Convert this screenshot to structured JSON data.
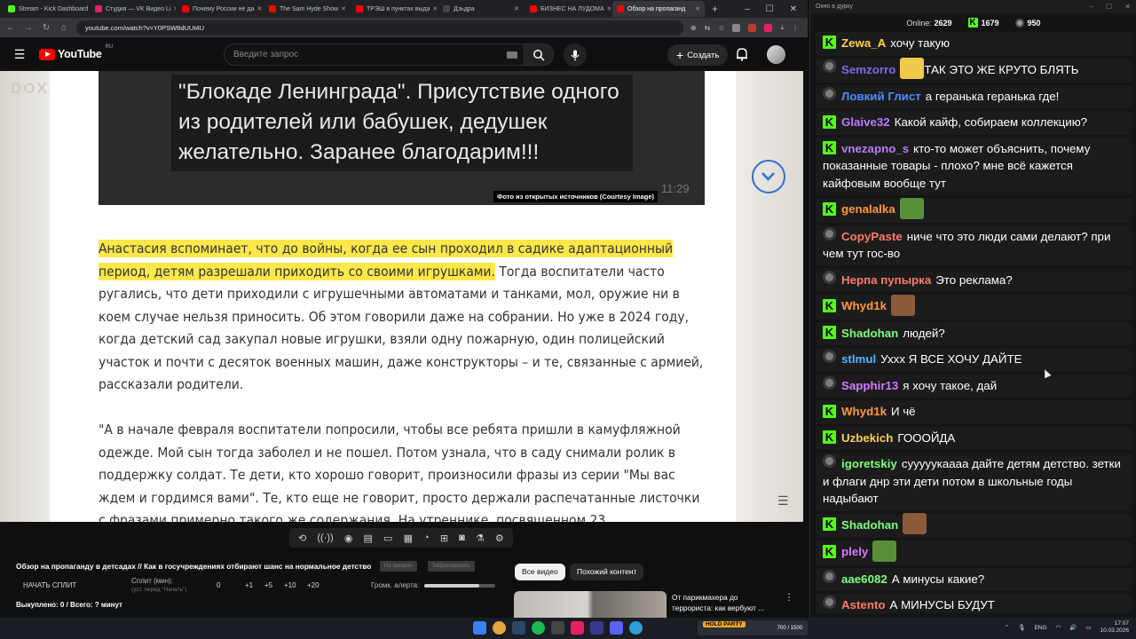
{
  "browser": {
    "tabs": [
      {
        "label": "Stream - Kick Dashboard",
        "color": "#53fc18"
      },
      {
        "label": "Студия — VK Видео Li",
        "color": "#e91e63"
      },
      {
        "label": "Почему России не да",
        "color": "#ff0000"
      },
      {
        "label": "The Sam Hyde Show",
        "color": "#ff0000"
      },
      {
        "label": "ТРЭШ в пунктах выда",
        "color": "#ff0000"
      },
      {
        "label": "Дзьдра",
        "color": "#444444"
      },
      {
        "label": "БИЗНЕС НА ЛУДОМА",
        "color": "#ff0000"
      },
      {
        "label": "Обзор на пропаганд",
        "color": "#ff0000"
      }
    ],
    "new_tab": "+",
    "url": "youtube.com/watch?v=Y0PSW8dUUt4U"
  },
  "youtube": {
    "logo_text": "YouTube",
    "logo_region": "RU",
    "search_placeholder": "Введите запрос",
    "create_label": "Создать"
  },
  "video": {
    "watermark": "DOXA",
    "photo_text": "\"Блокаде Ленинграда\". Присутствие одного из родителей или бабушек, дедушек желательно. Заранее благодарим!!!",
    "photo_time": "11:29",
    "photo_caption": "Фото из открытых источников (Courtesy Image)",
    "highlight": "Анастасия вспоминает, что до войны, когда ее сын проходил в садике адаптационный период, детям разрешали приходить со своими игрушками.",
    "paragraph1_rest": " Тогда воспитатели часто ругались, что дети приходили с игрушечными автоматами и танками, мол, оружие ни в коем случае нельзя приносить. Об этом говорили даже на собрании. Но уже в 2024 году, когда детский сад закупал новые игрушки, взяли одну пожарную, один полицейский участок и почти с десяток военных машин, даже конструкторы – и те, связанные с армией, рассказали родители.",
    "paragraph2": "\"А в начале февраля воспитатели попросили, чтобы все ребята пришли в камуфляжной одежде. Мой сын тогда заболел и не пошел. Потом узнала, что в саду снимали ролик в поддержку солдат. Те дети, кто хорошо говорит, произносили фразы из серии \"Мы вас ждем и гордимся вами\". Те, кто еще не говорит, просто держали распечатанные листочки с фразами примерно такого же содержания. На утреннике, посвященном 23"
  },
  "extension": {
    "title": "Обзор на пропаганду в детсадах // Как в госучреждениях отбирают шанс на нормальное детство",
    "chip1": "На аукцион",
    "chip2": "Забронировать",
    "split_start": "НАЧАТЬ СПЛИТ",
    "split_label": "Сплит (мин):",
    "split_sub": "(уст. перед \"Начать\")",
    "split_values": [
      "0",
      "+1",
      "+5",
      "+10",
      "+20"
    ],
    "alert_label": "Громк. алерта:",
    "alert_level": 0.78,
    "bought": "Выкуплено: 0 / Всего: ? минут"
  },
  "recommendations": {
    "chips": [
      "Все видео",
      "Похожий контент"
    ],
    "first_title": "От парикмахера до террориста: как вербуют ..."
  },
  "chat": {
    "window_title": "Окно в дурку",
    "online_label": "Online:",
    "online_count": "2629",
    "kick_count": "1679",
    "vk_count": "950",
    "messages": [
      {
        "src": "kick",
        "user": "Zewa_A",
        "color": "#ffd24c",
        "text": "хочу такую"
      },
      {
        "src": "vk",
        "user": "Semzorro",
        "color": "#7b68ee",
        "emote": "#f2c94c",
        "text": "ТАК ЭТО ЖЕ КРУТО БЛЯТЬ"
      },
      {
        "src": "vk",
        "user": "Ловкий Глист",
        "color": "#4f8cff",
        "text": "а геранька геранька где!"
      },
      {
        "src": "kick",
        "user": "Glaive32",
        "color": "#b97cff",
        "text": "Какой кайф, собираем коллекцию?"
      },
      {
        "src": "kick",
        "user": "vnezapno_s",
        "color": "#b97cff",
        "text": "кто-то может объяснить, почему показанные товары - плохо? мне всё кажется кайфовым вообще тут"
      },
      {
        "src": "kick",
        "user": "genalalka",
        "color": "#ff9a3c",
        "emote": "#5a8f3a",
        "text": ""
      },
      {
        "src": "vk",
        "user": "CopyPaste",
        "color": "#ff7a6b",
        "text": "ниче что это люди сами делают? при чем тут гос-во"
      },
      {
        "src": "vk",
        "user": "Нерпа пупырка",
        "color": "#ff7a6b",
        "text": "Это реклама?"
      },
      {
        "src": "kick",
        "user": "Whyd1k",
        "color": "#ff9a3c",
        "emote": "#8a5a3a",
        "text": ""
      },
      {
        "src": "kick",
        "user": "Shadohan",
        "color": "#7dff7d",
        "text": "людей?"
      },
      {
        "src": "vk",
        "user": "stlmul",
        "color": "#4fb8ff",
        "text": "Уххх Я ВСЕ ХОЧУ ДАЙТЕ"
      },
      {
        "src": "vk",
        "user": "Sapphir13",
        "color": "#d57bff",
        "text": "я хочу такое, дай"
      },
      {
        "src": "kick",
        "user": "Whyd1k",
        "color": "#ff9a3c",
        "text": "И чё"
      },
      {
        "src": "kick",
        "user": "Uzbekich",
        "color": "#ffd24c",
        "text": "ГООOЙДА"
      },
      {
        "src": "vk",
        "user": "igoretskiy",
        "color": "#7dff7d",
        "text": "сууууукаааа дайте детям детство. зетки и флаги днр эти дети потом в школьные годы надыбают"
      },
      {
        "src": "kick",
        "user": "Shadohan",
        "color": "#7dff7d",
        "emote": "#8a5a3a",
        "text": ""
      },
      {
        "src": "kick",
        "user": "plely",
        "color": "#d57bff",
        "emote": "#5a8f3a",
        "text": ""
      },
      {
        "src": "vk",
        "user": "aae6082",
        "color": "#7dff7d",
        "text": "А минусы какие?"
      },
      {
        "src": "vk",
        "user": "Astento",
        "color": "#ff7a6b",
        "text": "А МИНУСЫ БУДУТ"
      }
    ]
  },
  "taskbar": {
    "widget_label": "HOLD PARTY",
    "widget_counts": "700 / 1500",
    "lang": "ENG",
    "time": "17:07",
    "date": "10.03.2026"
  }
}
